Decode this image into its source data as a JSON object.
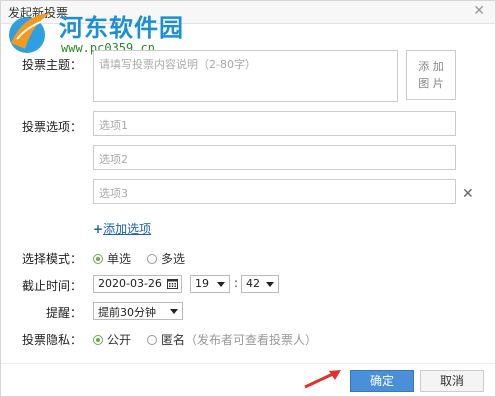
{
  "dialog": {
    "title": "发起新投票"
  },
  "watermark": {
    "site_name": "河东软件园",
    "url": "www.pc0359.cn"
  },
  "topic": {
    "label": "投票主题：",
    "placeholder": "请填写投票内容说明（2-80字）",
    "add_image": [
      "添 加",
      "图 片"
    ]
  },
  "options": {
    "label": "投票选项：",
    "items": [
      {
        "placeholder": "选项1"
      },
      {
        "placeholder": "选项2"
      },
      {
        "placeholder": "选项3"
      }
    ],
    "add_label": "添加选项"
  },
  "mode": {
    "label": "选择模式：",
    "choices": [
      {
        "label": "单选",
        "selected": true
      },
      {
        "label": "多选",
        "selected": false
      }
    ]
  },
  "deadline": {
    "label": "截止时间：",
    "date": "2020-03-26",
    "hour": "19",
    "minute": "42"
  },
  "reminder": {
    "label": "提醒：",
    "value": "提前30分钟"
  },
  "privacy": {
    "label": "投票隐私：",
    "public_label": "公开",
    "anonymous_label": "匿名",
    "anonymous_hint": "（发布者可查看投票人）",
    "public_selected": true
  },
  "footer": {
    "ok_label": "确定",
    "cancel_label": "取消"
  },
  "colors": {
    "accent": "#4a90d9",
    "radio_on": "#6aa84f",
    "link": "#1a62b5",
    "arrow": "#e0322b"
  }
}
